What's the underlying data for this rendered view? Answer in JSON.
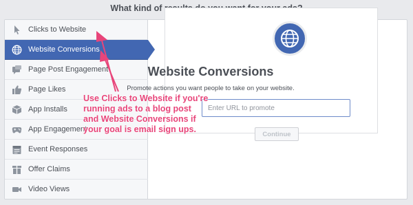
{
  "heading": "What kind of results do you want for your ads?",
  "sidebar": {
    "items": [
      {
        "label": "Clicks to Website",
        "icon": "cursor-icon"
      },
      {
        "label": "Website Conversions",
        "icon": "globe-icon",
        "active": true
      },
      {
        "label": "Page Post Engagement",
        "icon": "post-icon"
      },
      {
        "label": "Page Likes",
        "icon": "thumbs-up-icon"
      },
      {
        "label": "App Installs",
        "icon": "box-icon"
      },
      {
        "label": "App Engagement",
        "icon": "gamepad-icon"
      },
      {
        "label": "Event Responses",
        "icon": "calendar-icon"
      },
      {
        "label": "Offer Claims",
        "icon": "offer-icon"
      },
      {
        "label": "Video Views",
        "icon": "video-camera-icon"
      }
    ]
  },
  "main": {
    "title": "Website Conversions",
    "subtitle": "Promote actions you want people to take on your website.",
    "url_input": {
      "value": "",
      "placeholder": "Enter URL to promote"
    },
    "continue_label": "Continue"
  },
  "annotation": {
    "lines": [
      "Use Clicks to Website if you're",
      "running ads to a blog post",
      "and Website Conversions if",
      "your goal is email sign ups."
    ],
    "color": "#e8457a"
  },
  "colors": {
    "accent": "#4267b2",
    "background": "#e9eaed"
  }
}
